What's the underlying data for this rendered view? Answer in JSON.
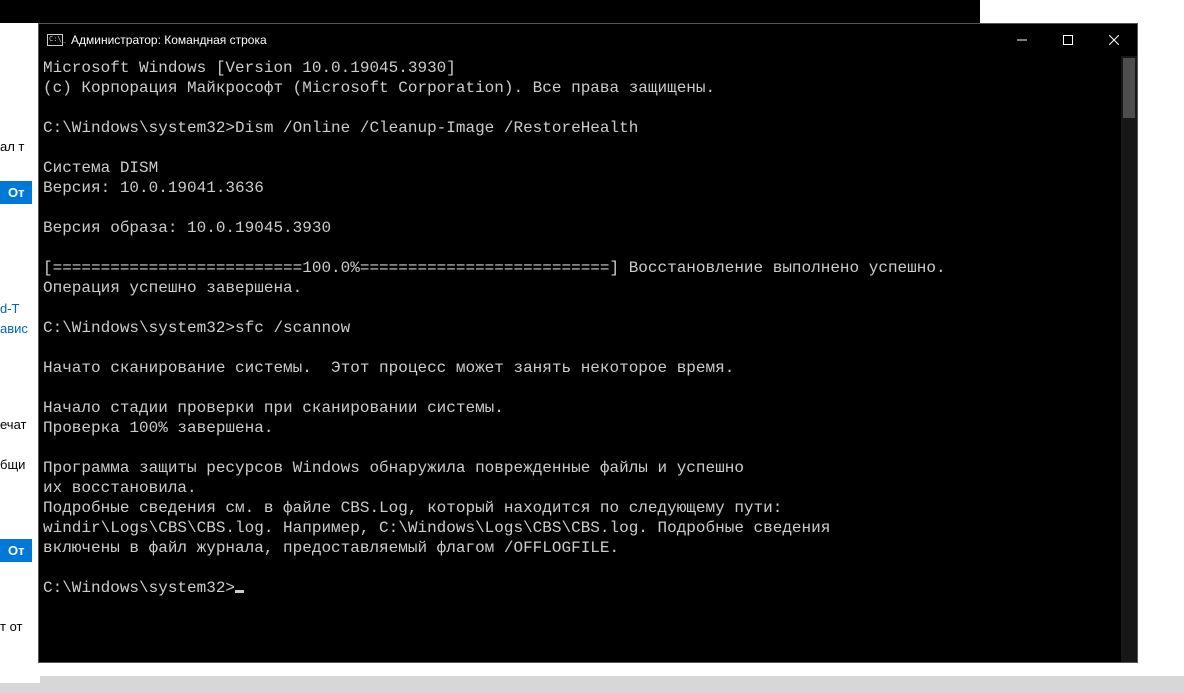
{
  "window": {
    "title": "Администратор: Командная строка"
  },
  "terminal": {
    "lines": [
      "Microsoft Windows [Version 10.0.19045.3930]",
      "(c) Корпорация Майкрософт (Microsoft Corporation). Все права защищены.",
      "",
      "C:\\Windows\\system32>Dism /Online /Cleanup-Image /RestoreHealth",
      "",
      "Cистема DISM",
      "Версия: 10.0.19041.3636",
      "",
      "Версия образа: 10.0.19045.3930",
      "",
      "[==========================100.0%==========================] Восстановление выполнено успешно.",
      "Операция успешно завершена.",
      "",
      "C:\\Windows\\system32>sfc /scannow",
      "",
      "Начато сканирование системы.  Этот процесс может занять некоторое время.",
      "",
      "Начало стадии проверки при сканировании системы.",
      "Проверка 100% завершена.",
      "",
      "Программа защиты ресурсов Windows обнаружила поврежденные файлы и успешно",
      "их восстановила.",
      "Подробные сведения см. в файле CBS.Log, который находится по следующему пути:",
      "windir\\Logs\\CBS\\CBS.log. Например, C:\\Windows\\Logs\\CBS\\CBS.log. Подробные сведения",
      "включены в файл журнала, предоставляемый флагом /OFFLOGFILE.",
      ""
    ],
    "prompt": "C:\\Windows\\system32>"
  },
  "bg": {
    "frag1": "ал т",
    "frag2": "От",
    "frag3": "d-T",
    "frag4": "авис",
    "frag5": "ечат",
    "frag6": "бщи",
    "frag7": "От",
    "frag8": "т от"
  }
}
